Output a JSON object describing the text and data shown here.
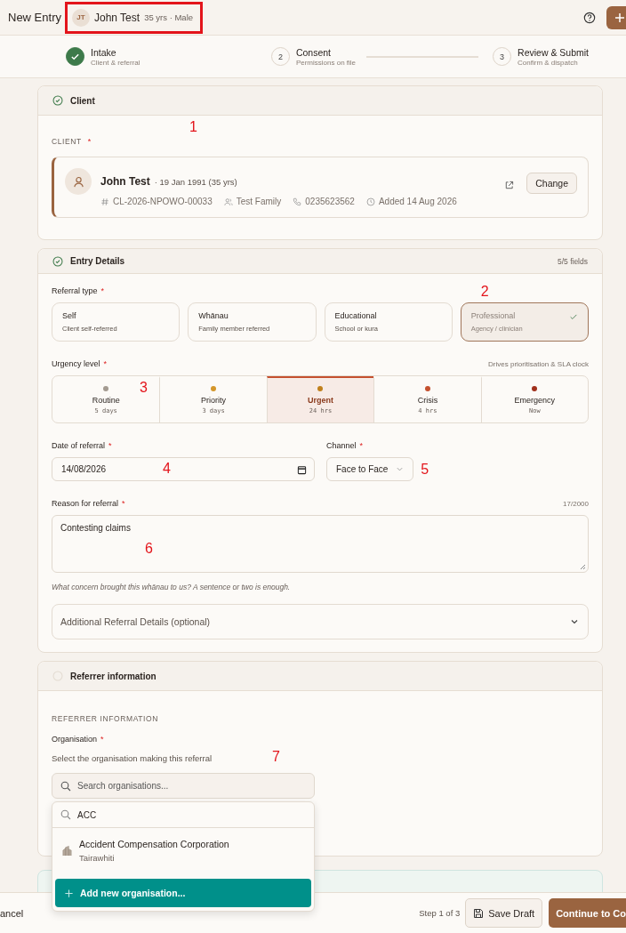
{
  "topbar": {
    "title": "New Entry",
    "patient": {
      "initials": "JT",
      "name": "John Test",
      "meta": "35 yrs · Male",
      "highlighted": true
    }
  },
  "stepper": [
    {
      "title": "Intake",
      "subtitle": "Client & referral",
      "done": true,
      "connector": false
    },
    {
      "number": "2",
      "title": "Consent",
      "subtitle": "Permissions on file",
      "done": false,
      "connector": true
    },
    {
      "number": "3",
      "title": "Review & Submit",
      "subtitle": "Confirm & dispatch",
      "done": false,
      "connector": false
    }
  ],
  "client_section": {
    "title": "Client",
    "complete": true,
    "annotation": "1",
    "label": "CLIENT",
    "asterisk": "*",
    "client": {
      "name": "John Test",
      "dob": "· 19 Jan 1991 (35 yrs)",
      "button": "Change",
      "meta": [
        {
          "kind": "id",
          "text": "CL-2026-NPOWO-00033"
        },
        {
          "kind": "family",
          "text": "Test Family"
        },
        {
          "kind": "phone",
          "text": "0235623562"
        },
        {
          "kind": "added",
          "text": "Added 14 Aug 2026"
        }
      ]
    }
  },
  "entry_section": {
    "title": "Entry Details",
    "complete": true,
    "counter": "5/5 fields",
    "referral_type": {
      "label": "Referral type",
      "asterisk": "*",
      "options": [
        {
          "title": "Self",
          "subtitle": "Client self-referred",
          "selected": false
        },
        {
          "title": "Whānau",
          "subtitle": "Family member referred",
          "selected": false
        },
        {
          "title": "Educational",
          "subtitle": "School or kura",
          "selected": false
        },
        {
          "title": "Professional",
          "subtitle": "Agency / clinician",
          "selected": true,
          "annotation": "2"
        }
      ]
    },
    "urgency": {
      "label": "Urgency level",
      "asterisk": "*",
      "hint": "Drives prioritisation & SLA clock",
      "levels": [
        {
          "name": "Routine",
          "time": "5 days",
          "color": "#a39a90",
          "selected": false,
          "annotation": "3"
        },
        {
          "name": "Priority",
          "time": "3 days",
          "color": "#d4962a",
          "selected": false
        },
        {
          "name": "Urgent",
          "time": "24 hrs",
          "color": "#c0801c",
          "selected": true
        },
        {
          "name": "Crisis",
          "time": "4 hrs",
          "color": "#c4502e",
          "selected": false
        },
        {
          "name": "Emergency",
          "time": "Now",
          "color": "#a0301c",
          "selected": false
        }
      ]
    },
    "date": {
      "label": "Date of referral",
      "asterisk": "*",
      "value": "14/08/2026",
      "annotation": "4"
    },
    "channel": {
      "label": "Channel",
      "asterisk": "*",
      "value": "Face to Face",
      "annotation": "5"
    },
    "reason": {
      "label": "Reason for referral",
      "asterisk": "*",
      "counter": "17/2000",
      "value": "Contesting claims",
      "annotation": "6",
      "help": "What concern brought this whānau to us? A sentence or two is enough."
    },
    "accordion": {
      "title": "Additional Referral Details (optional)",
      "expanded": false
    }
  },
  "referrer_section": {
    "title": "Referrer information",
    "complete": false,
    "label": "REFERRER INFORMATION",
    "organisation": {
      "label": "Organisation",
      "asterisk": "*",
      "description": "Select the organisation making this referral",
      "annotation": "7",
      "placeholder": "Search organisations...",
      "dropdown": {
        "query": "ACC",
        "results": [
          {
            "name": "Accident Compensation Corporation",
            "region": "Tairawhiti"
          }
        ],
        "add_button": "Add new organisation..."
      }
    }
  },
  "footer": {
    "cancel": "ancel",
    "step": "Step 1 of 3",
    "save": "Save Draft",
    "continue": "Continue to Co"
  }
}
